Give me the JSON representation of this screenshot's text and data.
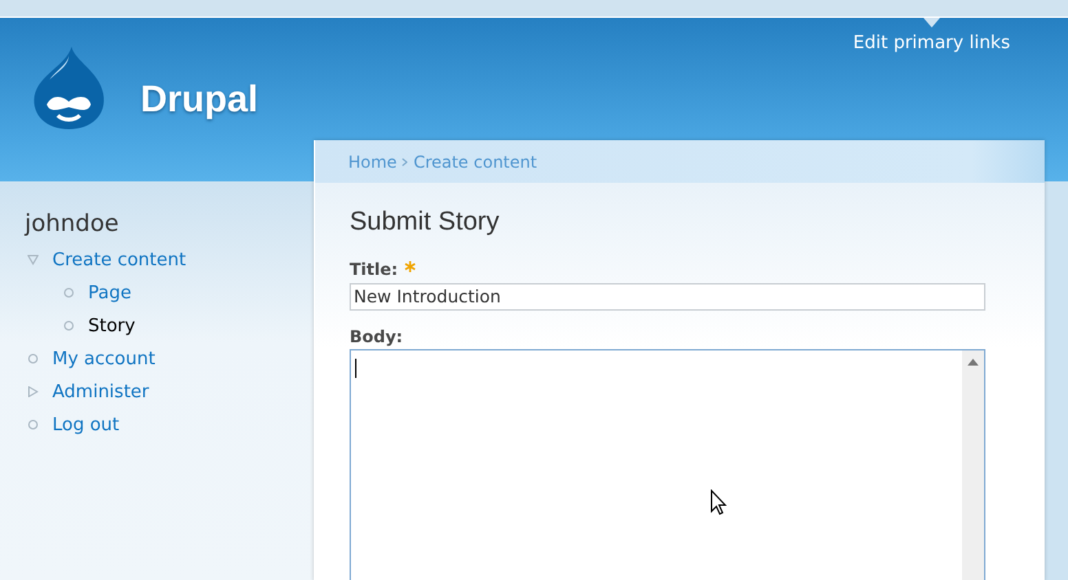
{
  "header": {
    "site_name": "Drupal",
    "primary_links_toggle": "Edit primary links"
  },
  "breadcrumb": [
    "Home",
    "Create content"
  ],
  "sidebar": {
    "user": "johndoe",
    "items": [
      {
        "label": "Create content",
        "kind": "branch",
        "expanded": true,
        "selected": false,
        "children": [
          {
            "label": "Page",
            "kind": "leaf",
            "selected": false
          },
          {
            "label": "Story",
            "kind": "leaf",
            "selected": true
          }
        ]
      },
      {
        "label": "My account",
        "kind": "leaf",
        "selected": false
      },
      {
        "label": "Administer",
        "kind": "branch",
        "expanded": false,
        "selected": false
      },
      {
        "label": "Log out",
        "kind": "leaf",
        "selected": false
      }
    ]
  },
  "form": {
    "heading": "Submit Story",
    "fields": [
      {
        "label": "Title:",
        "required": true,
        "kind": "text",
        "value": "New Introduction"
      },
      {
        "label": "Body:",
        "required": false,
        "kind": "textarea"
      }
    ]
  }
}
